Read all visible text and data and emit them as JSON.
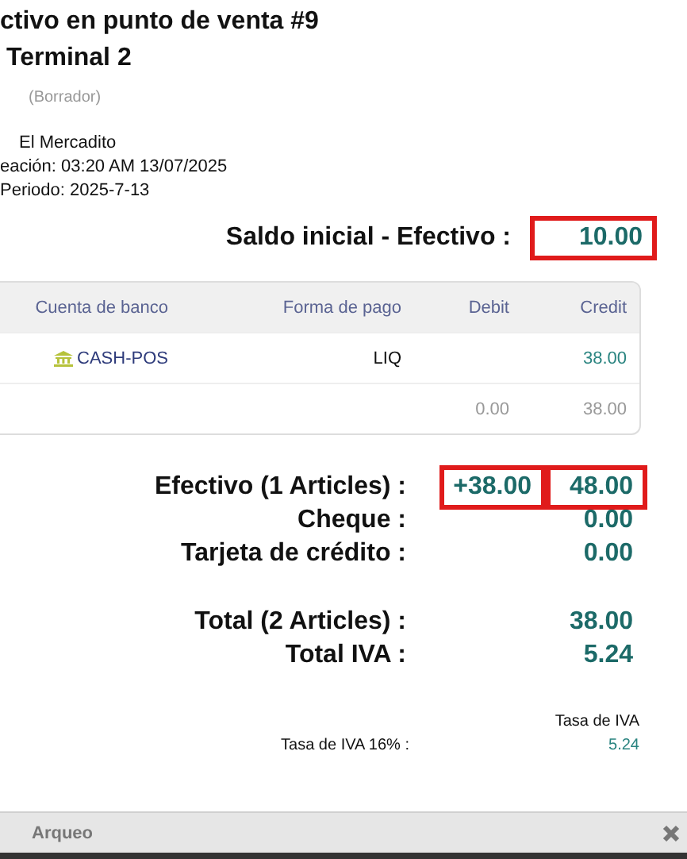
{
  "title": "ctivo en punto de venta #9",
  "subtitle": "Terminal 2",
  "status": "(Borrador)",
  "info": [
    "El Mercadito",
    "eación: 03:20 AM 13/07/2025",
    "Periodo: 2025-7-13"
  ],
  "opening": {
    "label": "Saldo inicial - Efectivo :",
    "value": "10.00",
    "highlighted": true
  },
  "table": {
    "columns": [
      "Cuenta de banco",
      "Forma de pago",
      "Debit",
      "Credit"
    ],
    "rows": [
      {
        "kind": "entry",
        "bank": "CASH-POS",
        "payment": "LIQ",
        "debit": "",
        "credit": "38.00"
      },
      {
        "kind": "total",
        "bank": "",
        "payment": "",
        "debit": "0.00",
        "credit": "38.00"
      }
    ]
  },
  "payments": [
    {
      "label": "Efectivo (1 Articles) :",
      "delta": "+38.00",
      "delta_highlighted": true,
      "value": "48.00",
      "highlighted": true
    },
    {
      "label": "Cheque :",
      "value": "0.00",
      "highlighted": false
    },
    {
      "label": "Tarjeta de crédito :",
      "value": "0.00",
      "highlighted": false
    }
  ],
  "totals": [
    {
      "label": "Total (2 Articles) :",
      "value": "38.00"
    },
    {
      "label": "Total IVA :",
      "value": "5.24"
    }
  ],
  "tax": {
    "heading": "Tasa de IVA",
    "label": "Tasa de IVA 16% :",
    "value": "5.24"
  },
  "footer": {
    "title": "Arqueo"
  }
}
